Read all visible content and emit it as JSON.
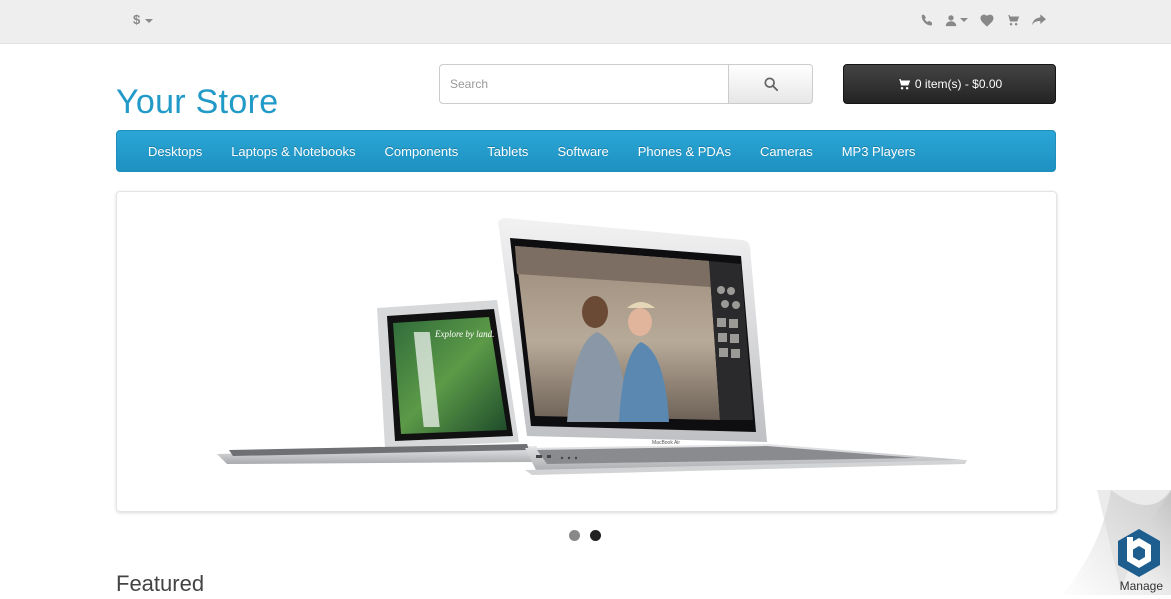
{
  "topbar": {
    "currency_symbol": "$",
    "icons": [
      "phone-icon",
      "user-icon",
      "heart-icon",
      "cart-icon",
      "share-icon"
    ]
  },
  "header": {
    "logo_text": "Your Store",
    "search_placeholder": "Search",
    "search_value": "",
    "cart_label": "0 item(s) - $0.00"
  },
  "menu": {
    "items": [
      "Desktops",
      "Laptops & Notebooks",
      "Components",
      "Tablets",
      "Software",
      "Phones & PDAs",
      "Cameras",
      "MP3 Players"
    ]
  },
  "slideshow": {
    "slide_count": 2,
    "active_index": 1,
    "laptop_small_screen_text": "Explore by land.",
    "laptop_brand": "MacBook Air"
  },
  "content": {
    "section_title": "Featured"
  },
  "corner": {
    "manage_label": "Manage"
  },
  "colors": {
    "brand": "#229ac8",
    "menu": "#229ac8",
    "cart": "#2a2a2a",
    "topbar": "#eeeeee"
  }
}
